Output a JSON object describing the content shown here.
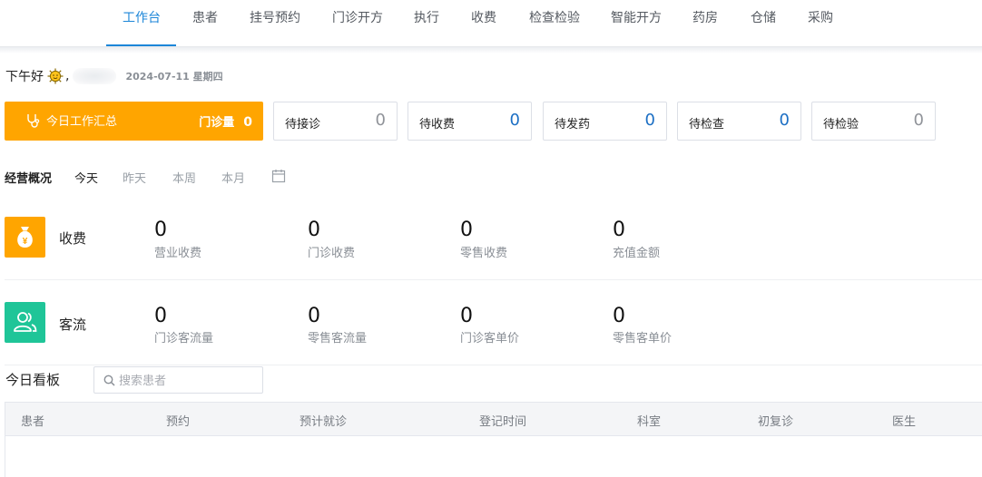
{
  "nav": {
    "items": [
      {
        "label": "工作台",
        "active": true
      },
      {
        "label": "患者"
      },
      {
        "label": "挂号预约"
      },
      {
        "label": "门诊开方"
      },
      {
        "label": "执行"
      },
      {
        "label": "收费"
      },
      {
        "label": "检查检验"
      },
      {
        "label": "智能开方"
      },
      {
        "label": "药房"
      },
      {
        "label": "仓储"
      },
      {
        "label": "采购"
      }
    ],
    "accent_color": "#1c86d8"
  },
  "greeting": {
    "text": "下午好",
    "icon": "sun-face-icon",
    "comma": ",",
    "date": "2024-07-11 星期四"
  },
  "summary": {
    "title": "今日工作汇总",
    "metric_label": "门诊量",
    "metric_value": "0",
    "color": "#ffa500"
  },
  "pending": [
    {
      "label": "待接诊",
      "value": "0",
      "color": "#909399"
    },
    {
      "label": "待收费",
      "value": "0",
      "color": "#1c6fc4"
    },
    {
      "label": "待发药",
      "value": "0",
      "color": "#1c6fc4"
    },
    {
      "label": "待检查",
      "value": "0",
      "color": "#1c6fc4"
    },
    {
      "label": "待检验",
      "value": "0",
      "color": "#909399"
    }
  ],
  "overview": {
    "title": "经营概况",
    "periods": [
      "今天",
      "昨天",
      "本周",
      "本月"
    ],
    "active_period": "今天",
    "calendar_icon": "calendar-icon"
  },
  "categories": [
    {
      "label": "收费",
      "icon": "money-bag-icon",
      "color": "#ffa500",
      "metrics": [
        {
          "value": "0",
          "label": "营业收费"
        },
        {
          "value": "0",
          "label": "门诊收费"
        },
        {
          "value": "0",
          "label": "零售收费"
        },
        {
          "value": "0",
          "label": "充值金额"
        }
      ]
    },
    {
      "label": "客流",
      "icon": "users-icon",
      "color": "#1fc598",
      "metrics": [
        {
          "value": "0",
          "label": "门诊客流量"
        },
        {
          "value": "0",
          "label": "零售客流量"
        },
        {
          "value": "0",
          "label": "门诊客单价"
        },
        {
          "value": "0",
          "label": "零售客单价"
        }
      ]
    }
  ],
  "board": {
    "title": "今日看板",
    "search_placeholder": "搜索患者",
    "search_value": "",
    "columns": [
      "患者",
      "预约",
      "预计就诊",
      "登记时间",
      "科室",
      "初复诊",
      "医生"
    ],
    "rows": []
  }
}
